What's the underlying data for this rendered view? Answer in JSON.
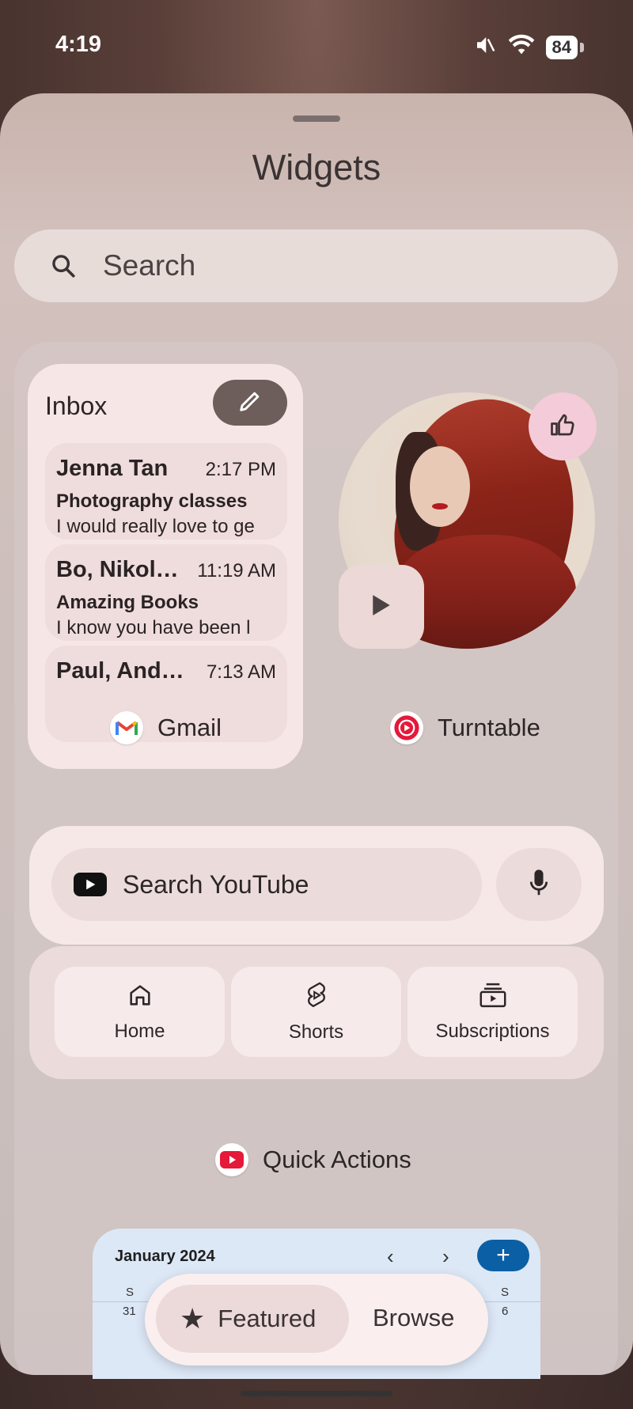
{
  "status_bar": {
    "time": "4:19",
    "battery": "84"
  },
  "sheet": {
    "title": "Widgets",
    "search_placeholder": "Search"
  },
  "gmail_widget": {
    "title": "Inbox",
    "emails": [
      {
        "sender": "Jenna Tan",
        "time": "2:17 PM",
        "subject": "Photography classes",
        "preview": "I would really love to ge"
      },
      {
        "sender": "Bo, Nikol…",
        "time": "11:19 AM",
        "subject": "Amazing Books",
        "preview": "I know you have been l"
      },
      {
        "sender": "Paul, And…",
        "time": "7:13 AM",
        "subject": "",
        "preview": ""
      }
    ],
    "app_label": "Gmail"
  },
  "turntable_widget": {
    "app_label": "Turntable"
  },
  "youtube_widget": {
    "search_label": "Search YouTube",
    "shortcuts": [
      {
        "label": "Home",
        "icon": "home-icon"
      },
      {
        "label": "Shorts",
        "icon": "shorts-icon"
      },
      {
        "label": "Subscriptions",
        "icon": "subscriptions-icon"
      }
    ],
    "app_label": "Quick Actions"
  },
  "calendar_widget": {
    "month": "January 2024",
    "days_of_week": [
      "S",
      "S"
    ],
    "days": [
      "31",
      "6"
    ]
  },
  "tabs": {
    "featured": "Featured",
    "browse": "Browse"
  },
  "colors": {
    "accent_blue": "#0b5fa5",
    "youtube_red": "#e5193a",
    "sheet": "#d3c1bd"
  }
}
